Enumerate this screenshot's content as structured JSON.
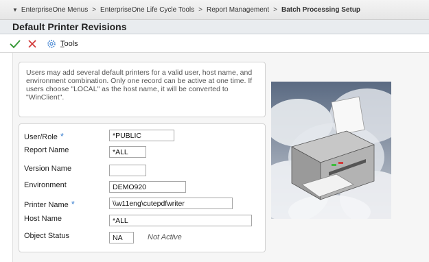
{
  "breadcrumb": {
    "items": [
      "EnterpriseOne Menus",
      "EnterpriseOne Life Cycle Tools",
      "Report Management",
      "Batch Processing Setup"
    ],
    "separator": ">"
  },
  "window": {
    "title": "Default Printer Revisions"
  },
  "toolbar": {
    "ok_icon": "check-icon",
    "cancel_icon": "x-icon",
    "tools_label_first": "T",
    "tools_label_rest": "ools"
  },
  "info": {
    "text": "Users may add several default printers for a valid user, host name, and environment combination. Only one record can be active at one time. If users choose \"LOCAL\" as the host name, it will be converted to \"WinClient\"."
  },
  "form": {
    "user_role": {
      "label": "User/Role",
      "value": "*PUBLIC",
      "required": true
    },
    "report_name": {
      "label": "Report Name",
      "value": "*ALL"
    },
    "version_name": {
      "label": "Version Name",
      "value": ""
    },
    "environment": {
      "label": "Environment",
      "value": "DEMO920"
    },
    "printer_name": {
      "label": "Printer Name",
      "value": "\\\\w11eng\\cutepdfwriter",
      "required": true
    },
    "host_name": {
      "label": "Host Name",
      "value": "*ALL"
    },
    "object_status": {
      "label": "Object Status",
      "value": "NA",
      "description": "Not Active"
    }
  },
  "colors": {
    "required_star": "#3a7fd0",
    "ok_green": "#3a9a3a",
    "cancel_red": "#d23a3a"
  }
}
